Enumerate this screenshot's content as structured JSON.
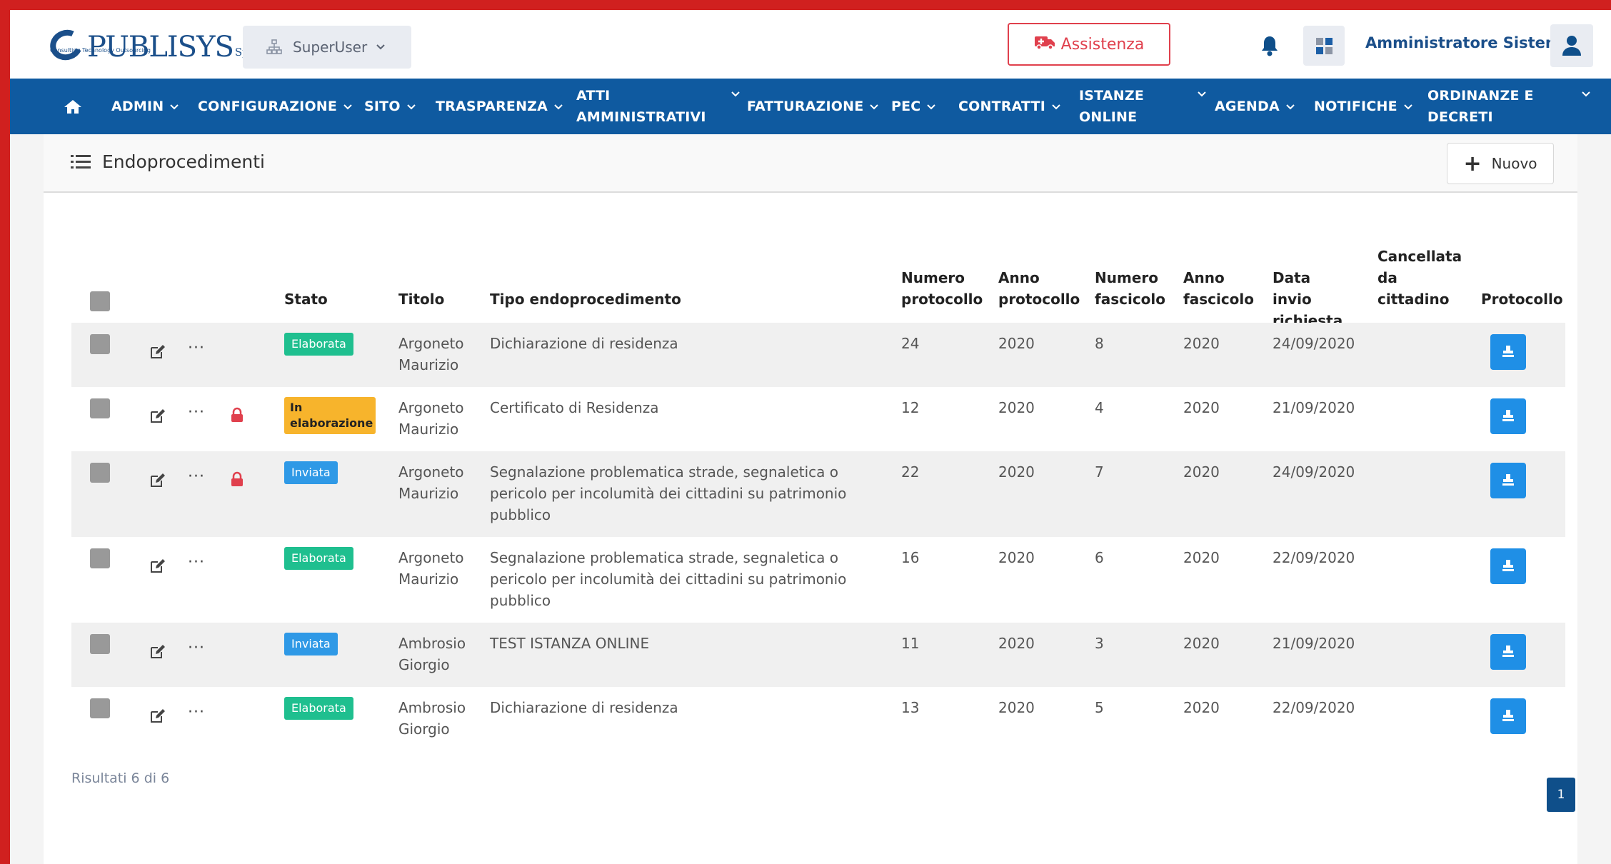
{
  "header": {
    "logo_text": "PUBLISYS",
    "logo_suffix": "SpA",
    "logo_tagline": "Consulting Technology Outsourcing",
    "role": "SuperUser",
    "assist_label": "Assistenza",
    "user_name": "Amministratore Sistema",
    "accent_color": "#0f5aa0",
    "danger_color": "#e0404d"
  },
  "nav": {
    "items": [
      {
        "label": "ADMIN"
      },
      {
        "label": "CONFIGURAZIONE"
      },
      {
        "label": "SITO"
      },
      {
        "label": "TRASPARENZA"
      },
      {
        "label": "ATTI AMMINISTRATIVI"
      },
      {
        "label": "FATTURAZIONE"
      },
      {
        "label": "PEC"
      },
      {
        "label": "CONTRATTI"
      },
      {
        "label": "ISTANZE ONLINE"
      },
      {
        "label": "AGENDA"
      },
      {
        "label": "NOTIFICHE"
      },
      {
        "label": "ORDINANZE E DECRETI"
      }
    ]
  },
  "page": {
    "title": "Endoprocedimenti",
    "new_label": "Nuovo",
    "results": "Risultati 6 di 6",
    "current_page": "1"
  },
  "table": {
    "headers": {
      "stato": "Stato",
      "titolo": "Titolo",
      "tipo": "Tipo endoprocedimento",
      "num_prot": "Numero protocollo",
      "anno_prot": "Anno protocollo",
      "num_fasc": "Numero fascicolo",
      "anno_fasc": "Anno fascicolo",
      "data_invio": "Data invio richiesta",
      "cancellata": "Cancellata da cittadino",
      "protocollo": "Protocollo"
    },
    "rows": [
      {
        "stato": "Elaborata",
        "stato_color": "green",
        "locked": false,
        "titolo": "Argoneto Maurizio",
        "tipo": "Dichiarazione di residenza",
        "num_prot": "24",
        "anno_prot": "2020",
        "num_fasc": "8",
        "anno_fasc": "2020",
        "data_invio": "24/09/2020"
      },
      {
        "stato": "In elaborazione",
        "stato_color": "orange",
        "locked": true,
        "titolo": "Argoneto Maurizio",
        "tipo": "Certificato di Residenza",
        "num_prot": "12",
        "anno_prot": "2020",
        "num_fasc": "4",
        "anno_fasc": "2020",
        "data_invio": "21/09/2020"
      },
      {
        "stato": "Inviata",
        "stato_color": "blue",
        "locked": true,
        "titolo": "Argoneto Maurizio",
        "tipo": "Segnalazione problematica strade, segnaletica o pericolo per incolumità dei cittadini su patrimonio pubblico",
        "num_prot": "22",
        "anno_prot": "2020",
        "num_fasc": "7",
        "anno_fasc": "2020",
        "data_invio": "24/09/2020"
      },
      {
        "stato": "Elaborata",
        "stato_color": "green",
        "locked": false,
        "titolo": "Argoneto Maurizio",
        "tipo": "Segnalazione problematica strade, segnaletica o pericolo per incolumità dei cittadini su patrimonio pubblico",
        "num_prot": "16",
        "anno_prot": "2020",
        "num_fasc": "6",
        "anno_fasc": "2020",
        "data_invio": "22/09/2020"
      },
      {
        "stato": "Inviata",
        "stato_color": "blue",
        "locked": false,
        "titolo": "Ambrosio Giorgio",
        "tipo": "TEST ISTANZA ONLINE",
        "num_prot": "11",
        "anno_prot": "2020",
        "num_fasc": "3",
        "anno_fasc": "2020",
        "data_invio": "21/09/2020"
      },
      {
        "stato": "Elaborata",
        "stato_color": "green",
        "locked": false,
        "titolo": "Ambrosio Giorgio",
        "tipo": "Dichiarazione di residenza",
        "num_prot": "13",
        "anno_prot": "2020",
        "num_fasc": "5",
        "anno_fasc": "2020",
        "data_invio": "22/09/2020"
      }
    ]
  }
}
